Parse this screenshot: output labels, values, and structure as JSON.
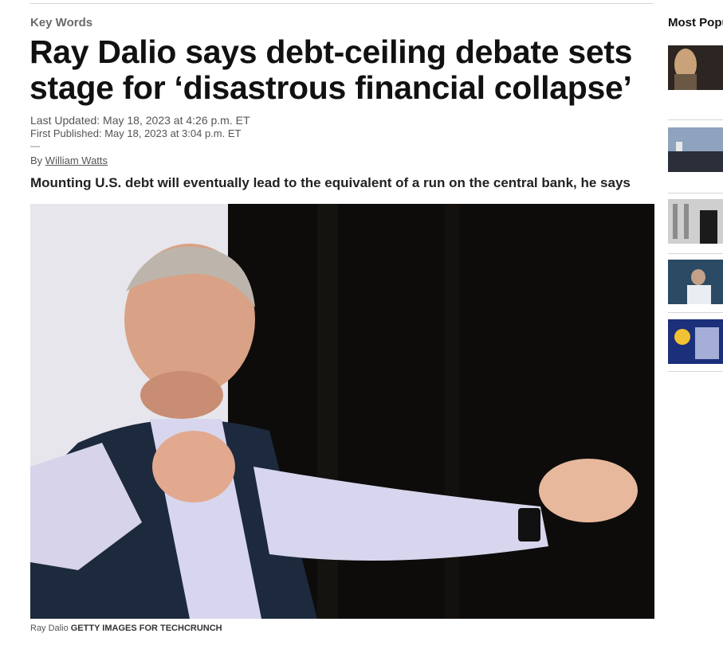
{
  "article": {
    "kicker": "Key Words",
    "headline": "Ray Dalio says debt-ceiling debate sets stage for ‘disastrous financial collapse’",
    "last_updated": "Last Updated: May 18, 2023 at 4:26 p.m. ET",
    "first_published": "First Published: May 18, 2023 at 3:04 p.m. ET",
    "separator": "—",
    "byline_prefix": "By",
    "author": "William Watts",
    "dek": "Mounting U.S. debt will eventually lead to the equivalent of a run on the central bank, he says",
    "caption_subject": "Ray Dalio",
    "caption_credit": "GETTY IMAGES FOR TECHCRUNCH"
  },
  "rail": {
    "title": "Most Popu"
  },
  "colors": {
    "text": "#222222",
    "muted": "#6a6a6a",
    "rule": "#d6d6d6",
    "photo_background": "#060606"
  }
}
